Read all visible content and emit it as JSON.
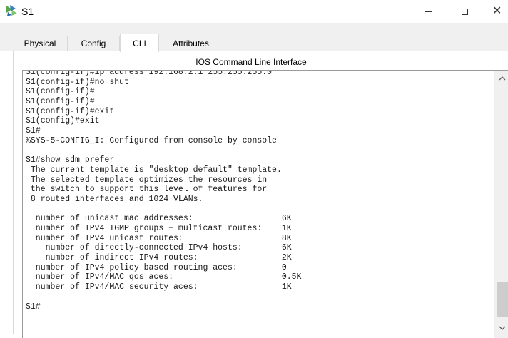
{
  "window": {
    "title": "S1",
    "icon": "packet-tracer-switch-icon"
  },
  "tabs": [
    {
      "label": "Physical",
      "active": false
    },
    {
      "label": "Config",
      "active": false
    },
    {
      "label": "CLI",
      "active": true
    },
    {
      "label": "Attributes",
      "active": false
    }
  ],
  "cli": {
    "panel_title": "IOS Command Line Interface",
    "lines": [
      "S1(config-if)#ip address 192.168.2.1 255.255.255.0",
      "S1(config-if)#no shut",
      "S1(config-if)#",
      "S1(config-if)#",
      "S1(config-if)#exit",
      "S1(config)#exit",
      "S1#",
      "%SYS-5-CONFIG_I: Configured from console by console",
      "",
      "S1#show sdm prefer",
      " The current template is \"desktop default\" template.",
      " The selected template optimizes the resources in",
      " the switch to support this level of features for",
      " 8 routed interfaces and 1024 VLANs.",
      "",
      "  number of unicast mac addresses:                  6K",
      "  number of IPv4 IGMP groups + multicast routes:    1K",
      "  number of IPv4 unicast routes:                    8K",
      "    number of directly-connected IPv4 hosts:        6K",
      "    number of indirect IPv4 routes:                 2K",
      "  number of IPv4 policy based routing aces:         0",
      "  number of IPv4/MAC qos aces:                      0.5K",
      "  number of IPv4/MAC security aces:                 1K",
      "",
      "S1#"
    ]
  }
}
